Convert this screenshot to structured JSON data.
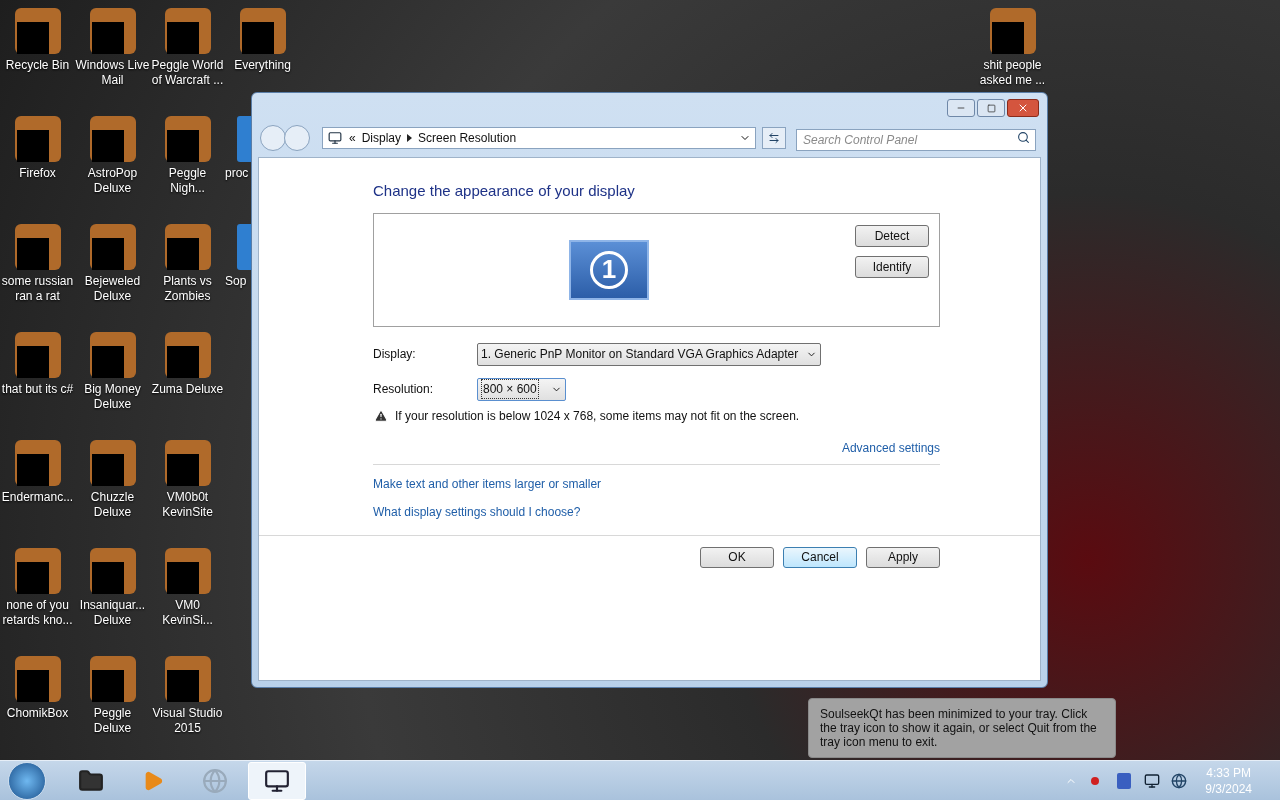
{
  "desktop": {
    "columns": [
      {
        "items": [
          {
            "label": "Recycle Bin",
            "kind": "full"
          },
          {
            "label": "Firefox",
            "kind": "full"
          },
          {
            "label": "some russian ran a rat",
            "kind": "full"
          },
          {
            "label": "that but its c#",
            "kind": "full"
          },
          {
            "label": "Endermanc...",
            "kind": "full"
          },
          {
            "label": "none of you retards kno...",
            "kind": "full"
          },
          {
            "label": "ChomikBox",
            "kind": "full"
          }
        ]
      },
      {
        "items": [
          {
            "label": "Windows Live Mail",
            "kind": "full"
          },
          {
            "label": "AstroPop Deluxe",
            "kind": "full"
          },
          {
            "label": "Bejeweled Deluxe",
            "kind": "full"
          },
          {
            "label": "Big Money Deluxe",
            "kind": "full"
          },
          {
            "label": "Chuzzle Deluxe",
            "kind": "full"
          },
          {
            "label": "Insaniquar... Deluxe",
            "kind": "full"
          },
          {
            "label": "Peggle Deluxe",
            "kind": "full"
          }
        ]
      },
      {
        "items": [
          {
            "label": "Peggle World of Warcraft ...",
            "kind": "full"
          },
          {
            "label": "Peggle Nigh...",
            "kind": "full"
          },
          {
            "label": "Plants vs Zombies",
            "kind": "full"
          },
          {
            "label": "Zuma Deluxe",
            "kind": "full"
          },
          {
            "label": "VM0b0t KevinSite",
            "kind": "full"
          },
          {
            "label": "VM0 KevinSi...",
            "kind": "full"
          },
          {
            "label": "Visual Studio 2015",
            "kind": "full"
          }
        ]
      },
      {
        "items": [
          {
            "label": "Everything",
            "kind": "full"
          },
          {
            "label": "proc",
            "kind": "partial"
          },
          {
            "label": "Sop",
            "kind": "partial"
          }
        ]
      }
    ],
    "right_icons": [
      {
        "label": "shit people asked me ..."
      }
    ]
  },
  "window": {
    "address": {
      "prefix": "«",
      "breadcrumb": [
        "Display",
        "Screen Resolution"
      ]
    },
    "search": {
      "placeholder": "Search Control Panel"
    },
    "heading": "Change the appearance of your display",
    "monitor_number": "1",
    "preview_buttons": [
      "Detect",
      "Identify"
    ],
    "fields": [
      {
        "label": "Display:",
        "value": "1. Generic PnP Monitor on Standard VGA Graphics Adapter",
        "focused": false
      },
      {
        "label": "Resolution:",
        "value": "800 × 600",
        "focused": true
      }
    ],
    "warning": "If your resolution is below 1024 x 768, some items may not fit on the screen.",
    "advanced_link": "Advanced settings",
    "links": [
      "Make text and other items larger or smaller",
      "What display settings should I choose?"
    ],
    "buttons": [
      {
        "label": "OK",
        "hovered": false
      },
      {
        "label": "Cancel",
        "hovered": true
      },
      {
        "label": "Apply",
        "hovered": false
      }
    ]
  },
  "balloon": {
    "text": "SoulseekQt has been minimized to your tray. Click the tray icon to show it again, or select Quit from the tray icon menu to exit."
  },
  "taskbar": {
    "buttons": [
      {
        "kind": "folder",
        "active": false
      },
      {
        "kind": "media",
        "active": false
      },
      {
        "kind": "globe",
        "active": false
      },
      {
        "kind": "display",
        "active": true
      }
    ],
    "clock": {
      "time": "4:33 PM",
      "date": "9/3/2024"
    }
  }
}
